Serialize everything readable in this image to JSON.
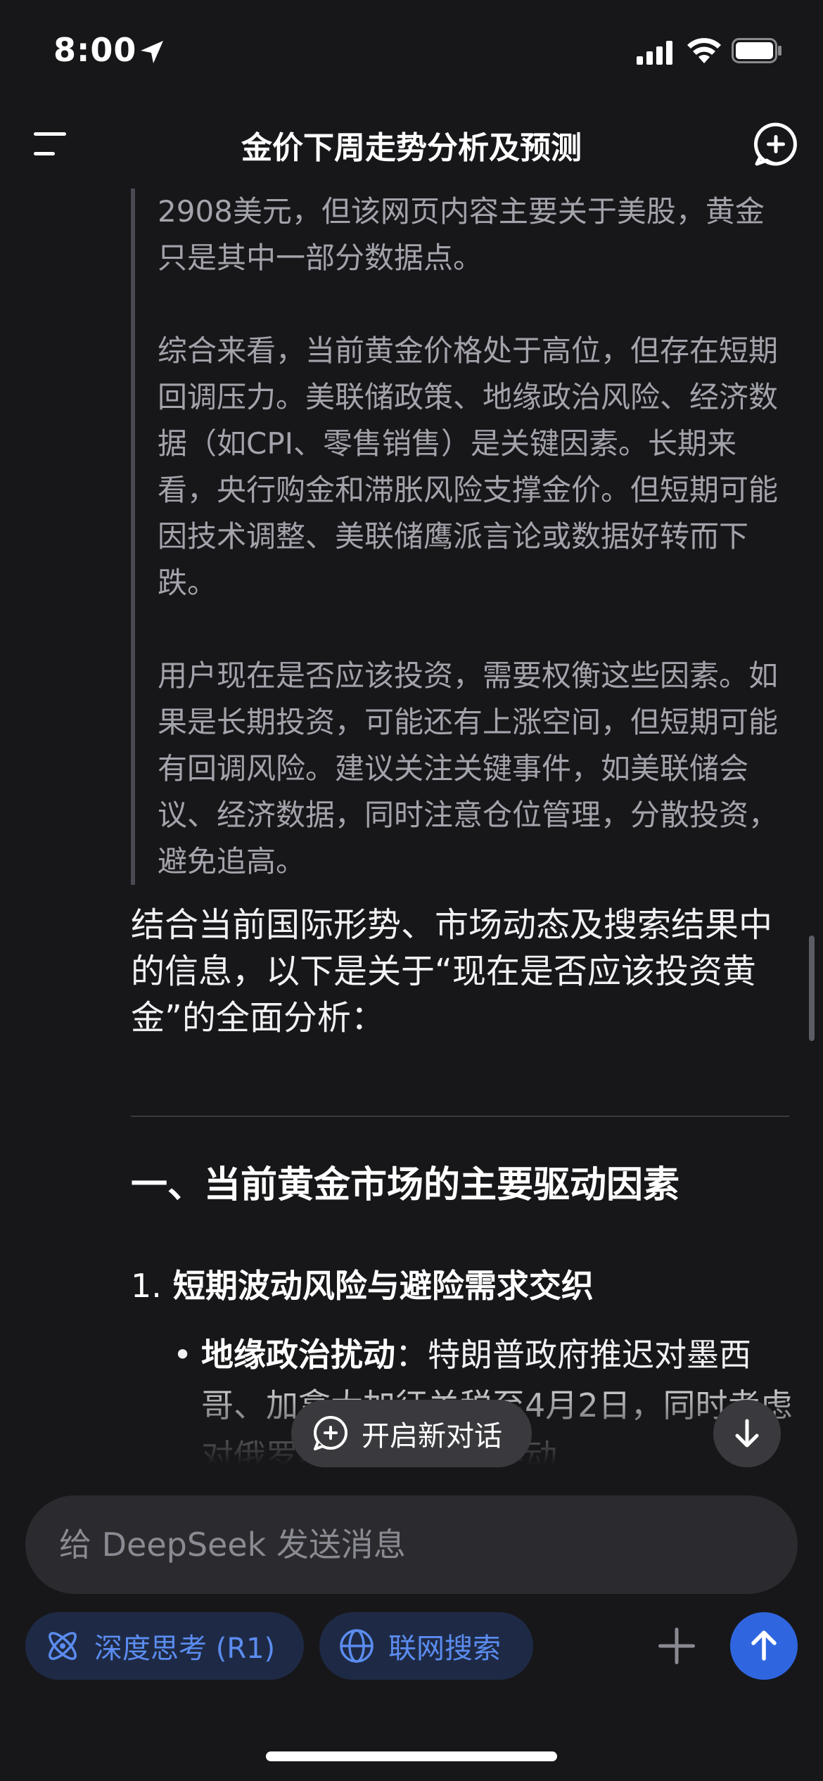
{
  "status_bar": {
    "time": "8:00"
  },
  "header": {
    "title": "金价下周走势分析及预测"
  },
  "thinking": {
    "paragraphs": [
      "2908美元，但该网页内容主要关于美股，黄金只是其中一部分数据点。",
      "综合来看，当前黄金价格处于高位，但存在短期回调压力。美联储政策、地缘政治风险、经济数据（如CPI、零售销售）是关键因素。长期来看，央行购金和滞胀风险支撑金价。但短期可能因技术调整、美联储鹰派言论或数据好转而下跌。",
      "用户现在是否应该投资，需要权衡这些因素。如果是长期投资，可能还有上涨空间，但短期可能有回调风险。建议关注关键事件，如美联储会议、经济数据，同时注意仓位管理，分散投资，避免追高。"
    ]
  },
  "answer": {
    "intro": "结合当前国际形势、市场动态及搜索结果中的信息，以下是关于“现在是否应该投资黄金”的全面分析：",
    "section_1_title": "一、当前黄金市场的主要驱动因素",
    "subsection_1_number": "1.",
    "subsection_1_title": "短期波动风险与避险需求交织",
    "bullet_1_bold": "地缘政治扰动",
    "bullet_1_text": "：特朗普政府推迟对墨西哥、加拿大加征关税至4月2日，同时考虑对俄罗斯实施制裁以推动"
  },
  "floating": {
    "new_chat_label": "开启新对话"
  },
  "composer": {
    "placeholder": "给 DeepSeek 发送消息",
    "deep_think_label": "深度思考 (R1)",
    "web_search_label": "联网搜索"
  },
  "colors": {
    "background": "#17171a",
    "accent": "#2f66e0",
    "chip_text": "#5b8cf0",
    "chip_bg": "#1e2a45"
  }
}
